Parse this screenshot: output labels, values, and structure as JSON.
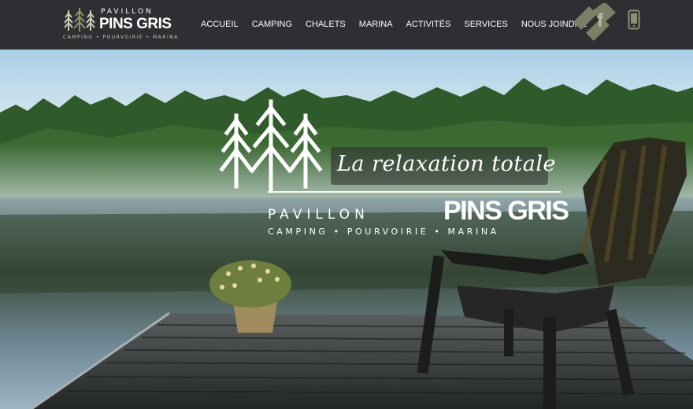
{
  "header": {
    "brand": {
      "small_name": "PAVILLON",
      "big_name": "PINS GRIS",
      "tagline": "CAMPING • POURVOIRIE • MARINA"
    },
    "nav": [
      {
        "label": "ACCUEIL"
      },
      {
        "label": "CAMPING"
      },
      {
        "label": "CHALETS"
      },
      {
        "label": "MARINA"
      },
      {
        "label": "ACTIVITÉS"
      },
      {
        "label": "SERVICES"
      },
      {
        "label": "NOUS JOINDRE"
      }
    ],
    "icons": [
      "facebook-logo-icon",
      "phone-icon"
    ]
  },
  "hero": {
    "slogan": "La relaxation totale",
    "logo_small": "PAVILLON",
    "logo_big": "PINS GRIS",
    "logo_tagline": "CAMPING • POURVOIRIE • MARINA"
  },
  "colors": {
    "header_bg": "#2d2f33",
    "text": "#ffffff",
    "brand_green": "#7a8b5a",
    "icon_olive": "#8d8f72"
  }
}
